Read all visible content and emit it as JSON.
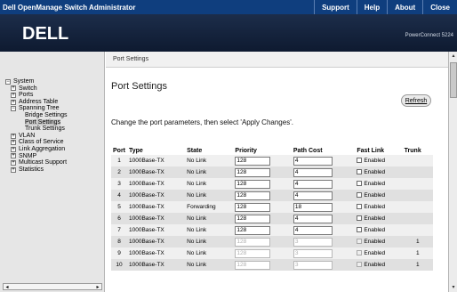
{
  "titlebar": {
    "app_title": "Dell OpenManage Switch Administrator",
    "links": [
      "Support",
      "Help",
      "About",
      "Close"
    ]
  },
  "banner": {
    "logo": "DELL",
    "product": "PowerConnect 5224"
  },
  "sidebar": {
    "tree": [
      {
        "label": "System",
        "level": 0,
        "toggle": "−"
      },
      {
        "label": "Switch",
        "level": 1,
        "toggle": "+"
      },
      {
        "label": "Ports",
        "level": 1,
        "toggle": "+"
      },
      {
        "label": "Address Table",
        "level": 1,
        "toggle": "+"
      },
      {
        "label": "Spanning Tree",
        "level": 1,
        "toggle": "−"
      },
      {
        "label": "Bridge Settings",
        "level": 2,
        "toggle": ""
      },
      {
        "label": "Port Settings",
        "level": 2,
        "toggle": "",
        "selected": true
      },
      {
        "label": "Trunk Settings",
        "level": 2,
        "toggle": ""
      },
      {
        "label": "VLAN",
        "level": 1,
        "toggle": "+"
      },
      {
        "label": "Class of Service",
        "level": 1,
        "toggle": "+"
      },
      {
        "label": "Link Aggregation",
        "level": 1,
        "toggle": "+"
      },
      {
        "label": "SNMP",
        "level": 1,
        "toggle": "+"
      },
      {
        "label": "Multicast Support",
        "level": 1,
        "toggle": "+"
      },
      {
        "label": "Statistics",
        "level": 1,
        "toggle": "+"
      }
    ]
  },
  "content": {
    "tab": "Port Settings",
    "heading": "Port Settings",
    "refresh": "Refresh",
    "instruction": "Change the port parameters, then select 'Apply Changes'.",
    "table": {
      "headers": [
        "Port",
        "Type",
        "State",
        "Priority",
        "Path Cost",
        "Fast Link",
        "Trunk"
      ],
      "enabled_label": "Enabled",
      "rows": [
        {
          "port": "1",
          "type": "1000Base-TX",
          "state": "No Link",
          "priority": "128",
          "path_cost": "4",
          "trunk": "",
          "disabled": false
        },
        {
          "port": "2",
          "type": "1000Base-TX",
          "state": "No Link",
          "priority": "128",
          "path_cost": "4",
          "trunk": "",
          "disabled": false
        },
        {
          "port": "3",
          "type": "1000Base-TX",
          "state": "No Link",
          "priority": "128",
          "path_cost": "4",
          "trunk": "",
          "disabled": false
        },
        {
          "port": "4",
          "type": "1000Base-TX",
          "state": "No Link",
          "priority": "128",
          "path_cost": "4",
          "trunk": "",
          "disabled": false
        },
        {
          "port": "5",
          "type": "1000Base-TX",
          "state": "Forwarding",
          "priority": "128",
          "path_cost": "18",
          "trunk": "",
          "disabled": false
        },
        {
          "port": "6",
          "type": "1000Base-TX",
          "state": "No Link",
          "priority": "128",
          "path_cost": "4",
          "trunk": "",
          "disabled": false
        },
        {
          "port": "7",
          "type": "1000Base-TX",
          "state": "No Link",
          "priority": "128",
          "path_cost": "4",
          "trunk": "",
          "disabled": false
        },
        {
          "port": "8",
          "type": "1000Base-TX",
          "state": "No Link",
          "priority": "128",
          "path_cost": "3",
          "trunk": "1",
          "disabled": true
        },
        {
          "port": "9",
          "type": "1000Base-TX",
          "state": "No Link",
          "priority": "128",
          "path_cost": "3",
          "trunk": "1",
          "disabled": true
        },
        {
          "port": "10",
          "type": "1000Base-TX",
          "state": "No Link",
          "priority": "128",
          "path_cost": "3",
          "trunk": "1",
          "disabled": true
        }
      ]
    }
  },
  "colors": {
    "titlebar": "#0f3e7e",
    "banner": "#1c2d4a",
    "sidebar": "#e6e6e6"
  },
  "icons": {
    "expand": "plus-box-icon",
    "collapse": "minus-box-icon",
    "checkbox": "checkbox-icon"
  }
}
